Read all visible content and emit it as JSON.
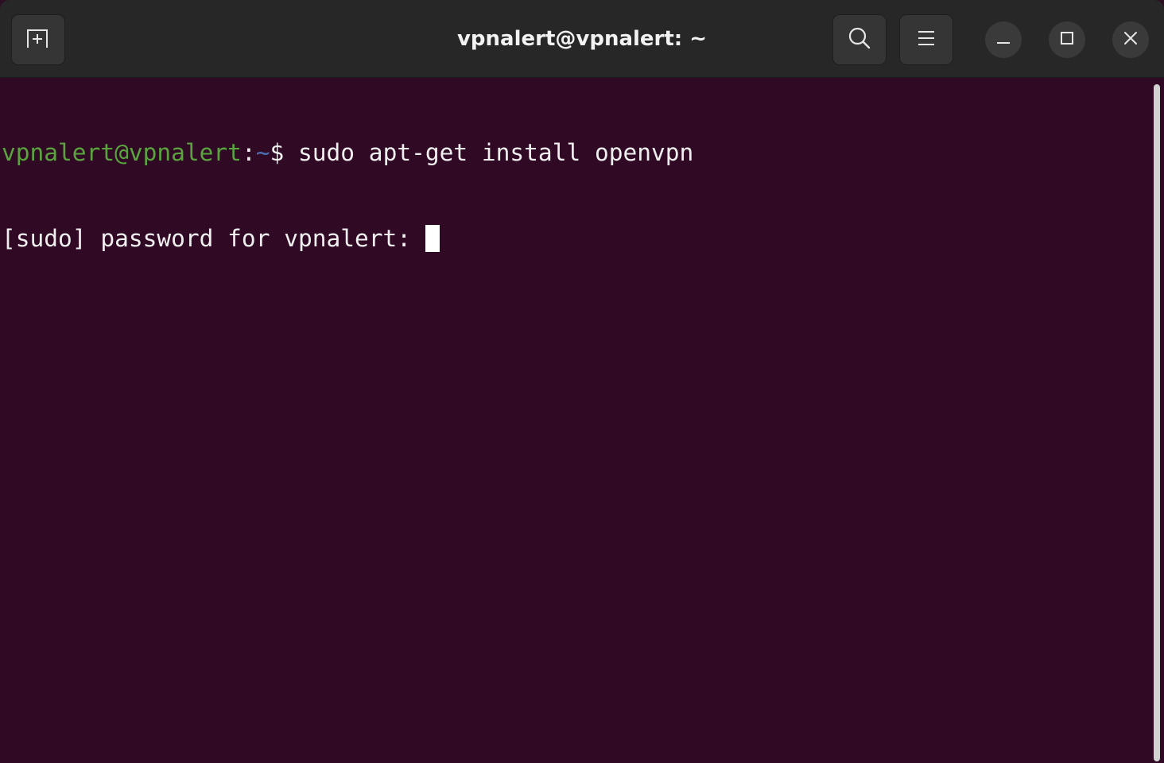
{
  "window": {
    "title": "vpnalert@vpnalert: ~"
  },
  "toolbar": {
    "new_tab_icon": "new-tab-icon",
    "search_icon": "search-icon",
    "menu_icon": "hamburger-menu-icon",
    "minimize_icon": "minimize-icon",
    "maximize_icon": "maximize-icon",
    "close_icon": "close-icon"
  },
  "terminal": {
    "lines": [
      {
        "user_host": "vpnalert@vpnalert",
        "colon": ":",
        "path": "~",
        "prompt_symbol": "$ ",
        "command": "sudo apt-get install openvpn"
      },
      {
        "text": "[sudo] password for vpnalert: "
      }
    ]
  },
  "colors": {
    "terminal_bg": "#300a24",
    "prompt_user": "#5aa33f",
    "prompt_path": "#4a6fb5",
    "text": "#efefef",
    "titlebar_bg": "#272727"
  }
}
